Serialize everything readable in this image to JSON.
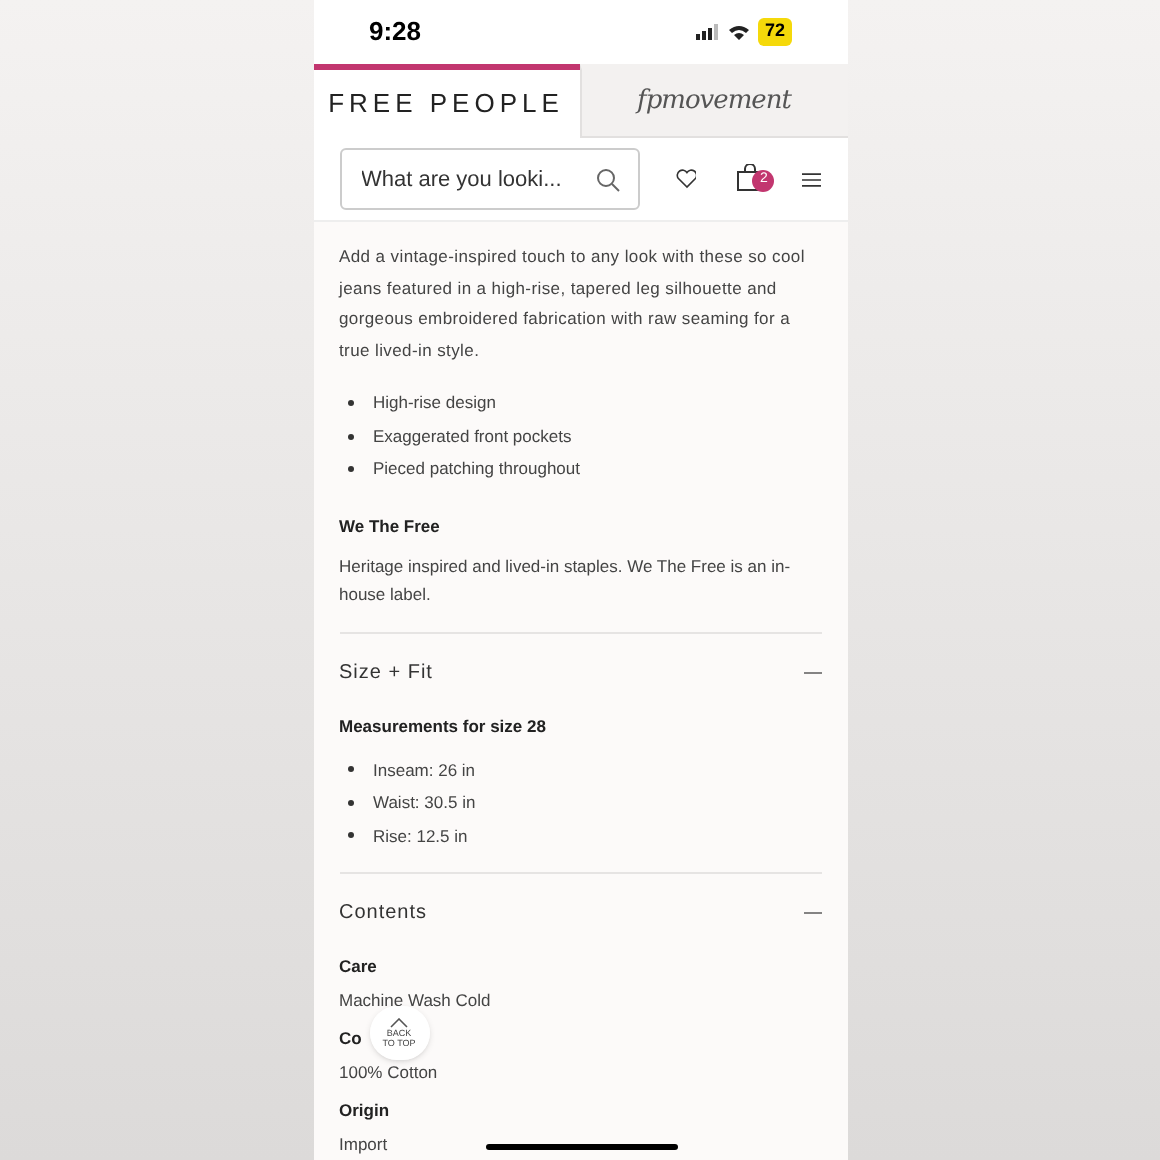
{
  "status_bar": {
    "time": "9:28",
    "battery": "72"
  },
  "tabs": [
    {
      "label": "FREE PEOPLE",
      "kind": "text",
      "selected": true
    },
    {
      "label": "fpmovement",
      "kind": "script",
      "selected": false
    }
  ],
  "search": {
    "placeholder": "What are you looki..."
  },
  "cart": {
    "count": "2"
  },
  "description": {
    "text": "Add a vintage-inspired touch to any look with these so cool jeans featured in a high-rise, tapered leg silhouette and gorgeous embroidered fabrication with raw seaming for a true lived-in style.",
    "bullets": [
      "High-rise design",
      "Exaggerated front pockets",
      "Pieced patching throughout"
    ],
    "brand_heading": "We The Free",
    "brand_text": "Heritage inspired and lived-in staples. We The Free is an in-house label."
  },
  "sections": [
    {
      "title": "Size + Fit",
      "expanded": true,
      "blocks": [
        {
          "heading": "Measurements for size 28",
          "bullets": [
            "Inseam: 26 in",
            "Waist: 30.5 in",
            "Rise: 12.5 in"
          ]
        }
      ]
    },
    {
      "title": "Contents",
      "expanded": true,
      "blocks": [
        {
          "heading": "Care",
          "text": "Machine Wash Cold"
        },
        {
          "heading": "Co",
          "text": "100% Cotton"
        },
        {
          "heading": "Origin",
          "text": "Import"
        }
      ]
    }
  ],
  "back_to_top": {
    "lines": [
      "BACK",
      "TO TOP"
    ]
  }
}
